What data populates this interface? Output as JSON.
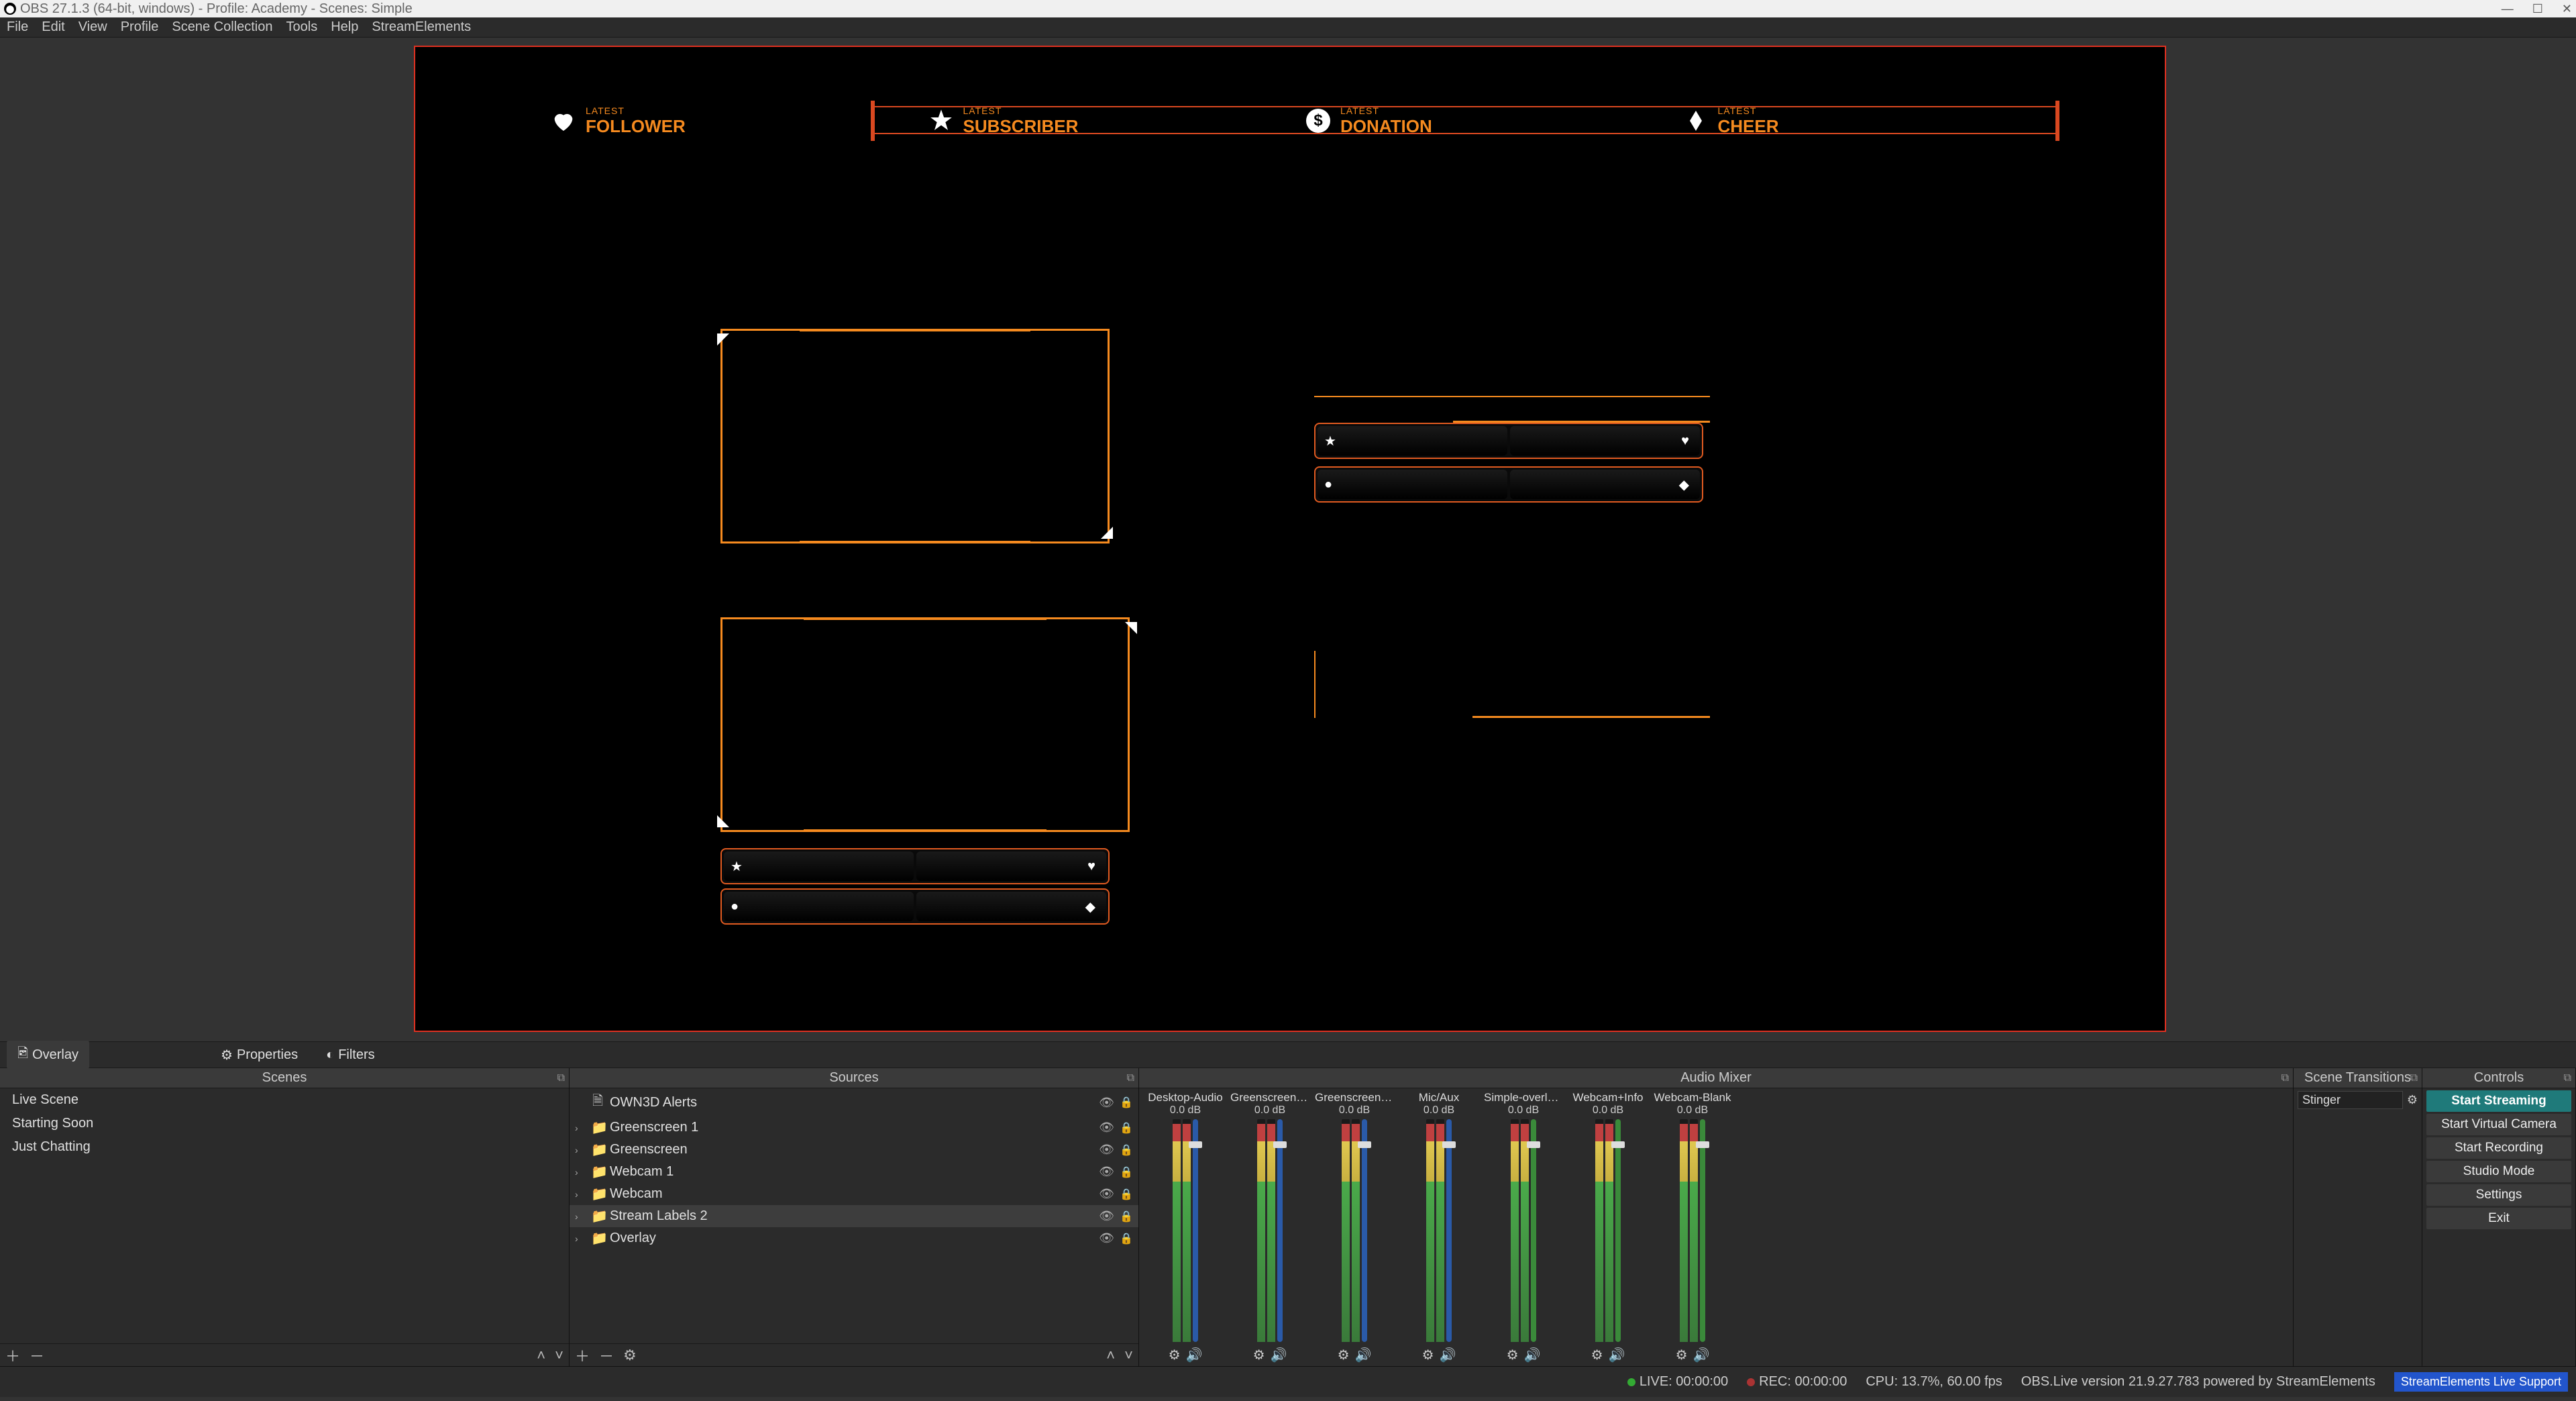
{
  "titlebar": {
    "title": "OBS 27.1.3 (64-bit, windows) - Profile: Academy - Scenes: Simple"
  },
  "menu": [
    "File",
    "Edit",
    "View",
    "Profile",
    "Scene Collection",
    "Tools",
    "Help",
    "StreamElements"
  ],
  "toolrow": {
    "overlay": "Overlay",
    "properties": "Properties",
    "filters": "Filters"
  },
  "overlay_top": [
    {
      "icon": "♥",
      "small": "LATEST",
      "big": "FOLLOWER"
    },
    {
      "icon": "★",
      "small": "LATEST",
      "big": "SUBSCRIBER"
    },
    {
      "icon": "$",
      "small": "LATEST",
      "big": "DONATION"
    },
    {
      "icon": "◆",
      "small": "LATEST",
      "big": "CHEER"
    }
  ],
  "docks": {
    "scenes": {
      "title": "Scenes",
      "items": [
        "Live Scene",
        "Starting Soon",
        "Just Chatting"
      ]
    },
    "sources": {
      "title": "Sources",
      "items": [
        {
          "icon": "🗎",
          "name": "OWN3D Alerts",
          "chev": ""
        },
        {
          "icon": "📁",
          "name": "Greenscreen 1",
          "chev": "›"
        },
        {
          "icon": "📁",
          "name": "Greenscreen",
          "chev": "›"
        },
        {
          "icon": "📁",
          "name": "Webcam 1",
          "chev": "›"
        },
        {
          "icon": "📁",
          "name": "Webcam",
          "chev": "›"
        },
        {
          "icon": "📁",
          "name": "Stream Labels 2",
          "chev": "›",
          "selected": true
        },
        {
          "icon": "📁",
          "name": "Overlay",
          "chev": "›"
        }
      ]
    },
    "mixer": {
      "title": "Audio Mixer",
      "channels": [
        {
          "name": "Desktop-Audio",
          "db": "0.0 dB",
          "color": "blue"
        },
        {
          "name": "Greenscreen+Inf",
          "db": "0.0 dB",
          "color": "blue"
        },
        {
          "name": "Greenscreen-Bla",
          "db": "0.0 dB",
          "color": "blue"
        },
        {
          "name": "Mic/Aux",
          "db": "0.0 dB",
          "color": "blue"
        },
        {
          "name": "Simple-overlay-o",
          "db": "0.0 dB",
          "color": "green"
        },
        {
          "name": "Webcam+Info",
          "db": "0.0 dB",
          "color": "green"
        },
        {
          "name": "Webcam-Blank",
          "db": "0.0 dB",
          "color": "green"
        }
      ]
    },
    "transitions": {
      "title": "Scene Transitions",
      "value": "Stinger"
    },
    "controls": {
      "title": "Controls",
      "buttons": [
        "Start Streaming",
        "Start Virtual Camera",
        "Start Recording",
        "Studio Mode",
        "Settings",
        "Exit"
      ]
    }
  },
  "statusbar": {
    "live": "LIVE: 00:00:00",
    "rec": "REC: 00:00:00",
    "cpu": "CPU: 13.7%, 60.00 fps",
    "version": "OBS.Live version 21.9.27.783 powered by StreamElements",
    "support": "StreamElements Live Support"
  }
}
